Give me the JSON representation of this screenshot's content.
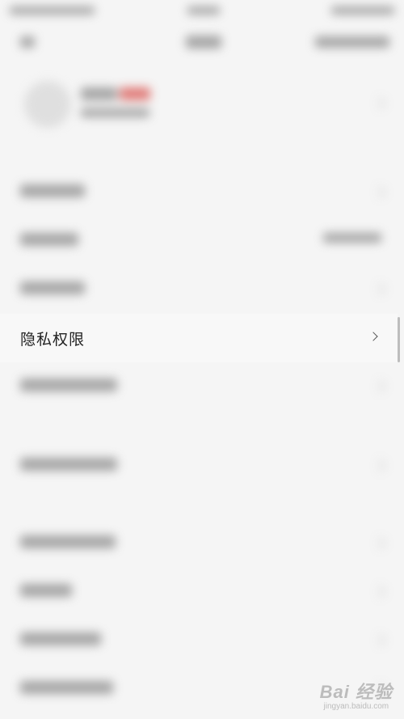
{
  "settings": {
    "highlighted_item": {
      "label": "隐私权限",
      "chevron_icon": "chevron-right-icon"
    }
  },
  "watermark": {
    "main": "Bai 经验",
    "sub": "jingyan.baidu.com"
  }
}
